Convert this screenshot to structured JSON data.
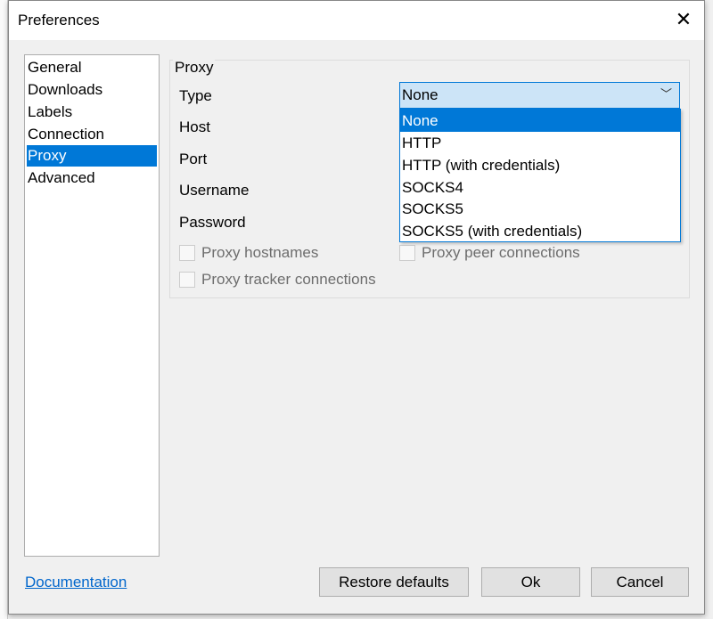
{
  "dialog": {
    "title": "Preferences"
  },
  "sidebar": {
    "items": [
      {
        "label": "General"
      },
      {
        "label": "Downloads"
      },
      {
        "label": "Labels"
      },
      {
        "label": "Connection"
      },
      {
        "label": "Proxy",
        "selected": true
      },
      {
        "label": "Advanced"
      }
    ]
  },
  "proxy": {
    "group_label": "Proxy",
    "type_label": "Type",
    "host_label": "Host",
    "port_label": "Port",
    "username_label": "Username",
    "password_label": "Password",
    "type_value": "None",
    "options": [
      "None",
      "HTTP",
      "HTTP (with credentials)",
      "SOCKS4",
      "SOCKS5",
      "SOCKS5 (with credentials)"
    ],
    "checkboxes": {
      "hostnames": "Proxy hostnames",
      "peer": "Proxy peer connections",
      "tracker": "Proxy tracker connections"
    }
  },
  "footer": {
    "documentation": "Documentation",
    "restore": "Restore defaults",
    "ok": "Ok",
    "cancel": "Cancel"
  },
  "colors": {
    "accent": "#0078d7",
    "link": "#0066cc"
  }
}
